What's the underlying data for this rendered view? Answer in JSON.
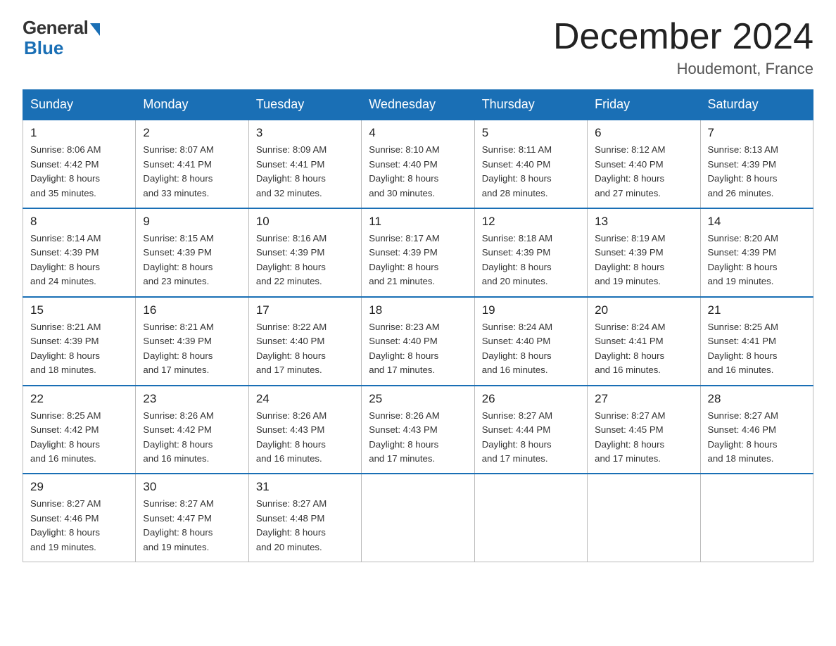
{
  "logo": {
    "general": "General",
    "blue": "Blue"
  },
  "title": "December 2024",
  "location": "Houdemont, France",
  "days_of_week": [
    "Sunday",
    "Monday",
    "Tuesday",
    "Wednesday",
    "Thursday",
    "Friday",
    "Saturday"
  ],
  "weeks": [
    [
      {
        "num": "1",
        "sunrise": "8:06 AM",
        "sunset": "4:42 PM",
        "daylight": "8 hours and 35 minutes."
      },
      {
        "num": "2",
        "sunrise": "8:07 AM",
        "sunset": "4:41 PM",
        "daylight": "8 hours and 33 minutes."
      },
      {
        "num": "3",
        "sunrise": "8:09 AM",
        "sunset": "4:41 PM",
        "daylight": "8 hours and 32 minutes."
      },
      {
        "num": "4",
        "sunrise": "8:10 AM",
        "sunset": "4:40 PM",
        "daylight": "8 hours and 30 minutes."
      },
      {
        "num": "5",
        "sunrise": "8:11 AM",
        "sunset": "4:40 PM",
        "daylight": "8 hours and 28 minutes."
      },
      {
        "num": "6",
        "sunrise": "8:12 AM",
        "sunset": "4:40 PM",
        "daylight": "8 hours and 27 minutes."
      },
      {
        "num": "7",
        "sunrise": "8:13 AM",
        "sunset": "4:39 PM",
        "daylight": "8 hours and 26 minutes."
      }
    ],
    [
      {
        "num": "8",
        "sunrise": "8:14 AM",
        "sunset": "4:39 PM",
        "daylight": "8 hours and 24 minutes."
      },
      {
        "num": "9",
        "sunrise": "8:15 AM",
        "sunset": "4:39 PM",
        "daylight": "8 hours and 23 minutes."
      },
      {
        "num": "10",
        "sunrise": "8:16 AM",
        "sunset": "4:39 PM",
        "daylight": "8 hours and 22 minutes."
      },
      {
        "num": "11",
        "sunrise": "8:17 AM",
        "sunset": "4:39 PM",
        "daylight": "8 hours and 21 minutes."
      },
      {
        "num": "12",
        "sunrise": "8:18 AM",
        "sunset": "4:39 PM",
        "daylight": "8 hours and 20 minutes."
      },
      {
        "num": "13",
        "sunrise": "8:19 AM",
        "sunset": "4:39 PM",
        "daylight": "8 hours and 19 minutes."
      },
      {
        "num": "14",
        "sunrise": "8:20 AM",
        "sunset": "4:39 PM",
        "daylight": "8 hours and 19 minutes."
      }
    ],
    [
      {
        "num": "15",
        "sunrise": "8:21 AM",
        "sunset": "4:39 PM",
        "daylight": "8 hours and 18 minutes."
      },
      {
        "num": "16",
        "sunrise": "8:21 AM",
        "sunset": "4:39 PM",
        "daylight": "8 hours and 17 minutes."
      },
      {
        "num": "17",
        "sunrise": "8:22 AM",
        "sunset": "4:40 PM",
        "daylight": "8 hours and 17 minutes."
      },
      {
        "num": "18",
        "sunrise": "8:23 AM",
        "sunset": "4:40 PM",
        "daylight": "8 hours and 17 minutes."
      },
      {
        "num": "19",
        "sunrise": "8:24 AM",
        "sunset": "4:40 PM",
        "daylight": "8 hours and 16 minutes."
      },
      {
        "num": "20",
        "sunrise": "8:24 AM",
        "sunset": "4:41 PM",
        "daylight": "8 hours and 16 minutes."
      },
      {
        "num": "21",
        "sunrise": "8:25 AM",
        "sunset": "4:41 PM",
        "daylight": "8 hours and 16 minutes."
      }
    ],
    [
      {
        "num": "22",
        "sunrise": "8:25 AM",
        "sunset": "4:42 PM",
        "daylight": "8 hours and 16 minutes."
      },
      {
        "num": "23",
        "sunrise": "8:26 AM",
        "sunset": "4:42 PM",
        "daylight": "8 hours and 16 minutes."
      },
      {
        "num": "24",
        "sunrise": "8:26 AM",
        "sunset": "4:43 PM",
        "daylight": "8 hours and 16 minutes."
      },
      {
        "num": "25",
        "sunrise": "8:26 AM",
        "sunset": "4:43 PM",
        "daylight": "8 hours and 17 minutes."
      },
      {
        "num": "26",
        "sunrise": "8:27 AM",
        "sunset": "4:44 PM",
        "daylight": "8 hours and 17 minutes."
      },
      {
        "num": "27",
        "sunrise": "8:27 AM",
        "sunset": "4:45 PM",
        "daylight": "8 hours and 17 minutes."
      },
      {
        "num": "28",
        "sunrise": "8:27 AM",
        "sunset": "4:46 PM",
        "daylight": "8 hours and 18 minutes."
      }
    ],
    [
      {
        "num": "29",
        "sunrise": "8:27 AM",
        "sunset": "4:46 PM",
        "daylight": "8 hours and 19 minutes."
      },
      {
        "num": "30",
        "sunrise": "8:27 AM",
        "sunset": "4:47 PM",
        "daylight": "8 hours and 19 minutes."
      },
      {
        "num": "31",
        "sunrise": "8:27 AM",
        "sunset": "4:48 PM",
        "daylight": "8 hours and 20 minutes."
      },
      null,
      null,
      null,
      null
    ]
  ],
  "labels": {
    "sunrise": "Sunrise:",
    "sunset": "Sunset:",
    "daylight": "Daylight:"
  }
}
